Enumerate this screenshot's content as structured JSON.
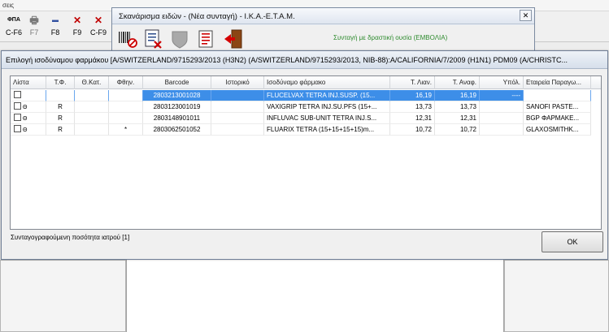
{
  "background": {
    "menu_fragment": "σεις",
    "toolbar": [
      {
        "icon": "fpa-icon",
        "glyph": "ΦΠΑ",
        "label": "C-F6"
      },
      {
        "icon": "printer-icon",
        "glyph": "🖶",
        "label": "F7"
      },
      {
        "icon": "tool-icon",
        "glyph": "▬",
        "label": "F8"
      },
      {
        "icon": "delete-icon",
        "glyph": "✕",
        "label": "F9"
      },
      {
        "icon": "cancel-document-icon",
        "glyph": "✕",
        "label": "C-F9"
      }
    ]
  },
  "scan_window": {
    "title": "Σκανάρισμα ειδών - (Νέα συνταγή) - Ι.Κ.Α.-Ε.Τ.Α.Μ.",
    "close_glyph": "✕",
    "status_text": "Συνταγή με δραστική ουσία (ΕΜΒΟΛΙΑ)",
    "colors": {
      "status": "#2e8b2e"
    }
  },
  "dialog": {
    "title": "Επιλογή ισοδύναμου φαρμάκου [A/SWITZERLAND/9715293/2013 (H3N2) (A/SWITZERLAND/9715293/2013, NIB-88):A/CALIFORNIA/7/2009 (H1N1) PDM09 (A/CHRISTC...",
    "columns": [
      "Λίστα",
      "Τ.Φ.",
      "Θ.Κατ.",
      "Φθην.",
      "Barcode",
      "Ιστορικό",
      "Ισοδύναμο φάρμακο",
      "Τ. Λιαν.",
      "Τ. Αναφ.",
      "Υπόλ.",
      "Εταιρεία Παραγω..."
    ],
    "rows": [
      {
        "lista": "",
        "tf": "",
        "thkat": "",
        "fthin": "",
        "barcode": "2803213001028",
        "istoriko": "",
        "drug": "FLUCELVAX TETRA INJ.SUSP. (15...",
        "lian": "16,19",
        "anaf": "16,19",
        "ypol": "----",
        "company": "",
        "selected": true,
        "priority": ""
      },
      {
        "lista": "",
        "tf": "R",
        "thkat": "",
        "fthin": "",
        "barcode": "2803123001019",
        "istoriko": "",
        "drug": "VAXIGRIP TETRA  INJ.SU.PFS (15+...",
        "lian": "13,73",
        "anaf": "13,73",
        "ypol": "",
        "company": "SANOFI PASTE...",
        "selected": false,
        "priority": "Θ"
      },
      {
        "lista": "",
        "tf": "R",
        "thkat": "",
        "fthin": "",
        "barcode": "2803148901011",
        "istoriko": "",
        "drug": "INFLUVAC SUB-UNIT TETRA INJ.S...",
        "lian": "12,31",
        "anaf": "12,31",
        "ypol": "",
        "company": "BGP ΦΑΡΜΑΚΕ...",
        "selected": false,
        "priority": "Θ"
      },
      {
        "lista": "",
        "tf": "R",
        "thkat": "",
        "fthin": "*",
        "barcode": "2803062501052",
        "istoriko": "",
        "drug": "FLUARIX TETRA (15+15+15+15)m...",
        "lian": "10,72",
        "anaf": "10,72",
        "ypol": "",
        "company": "GLAXOSMITHK...",
        "selected": false,
        "priority": "Θ"
      }
    ],
    "footer_text": "Συνταγογραφούμενη ποσότητα ιατρού [1]",
    "ok_label": "OK",
    "colors": {
      "selection": "#3d8ee8"
    }
  }
}
